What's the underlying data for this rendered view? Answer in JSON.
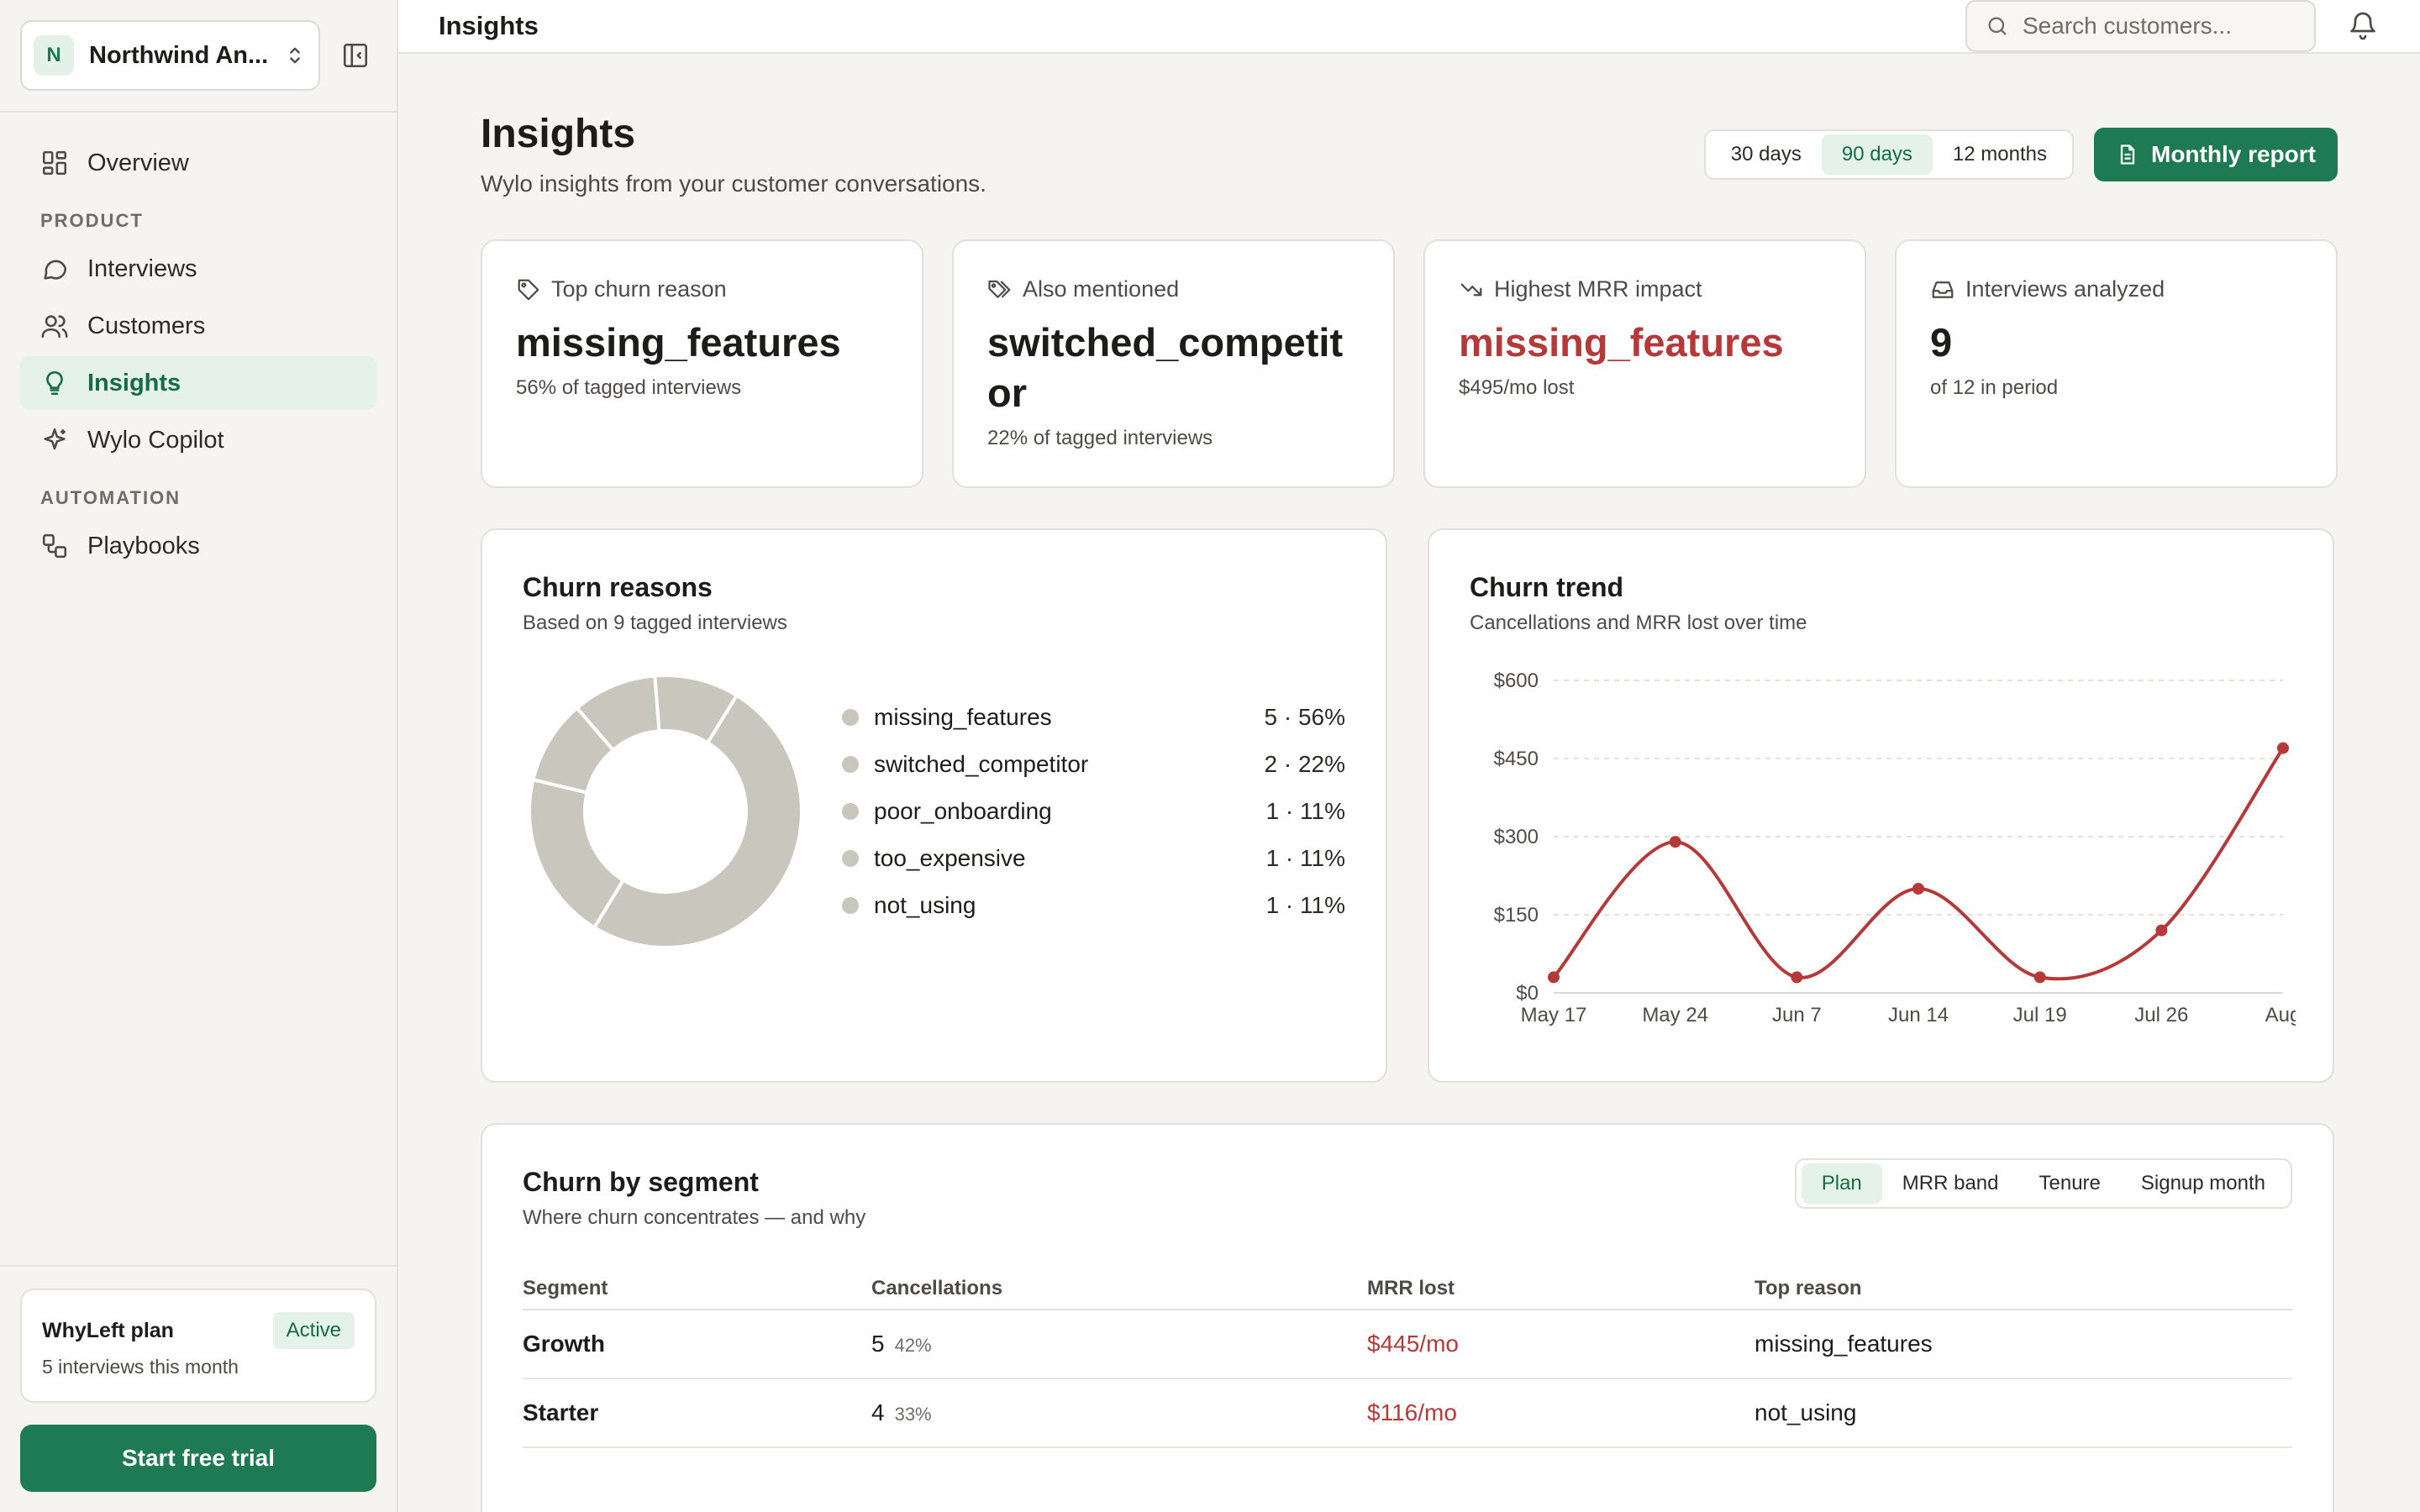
{
  "workspace": {
    "initial": "N",
    "name": "Northwind An..."
  },
  "nav": {
    "overview": "Overview",
    "section_product": "PRODUCT",
    "interviews": "Interviews",
    "customers": "Customers",
    "insights": "Insights",
    "copilot": "Wylo Copilot",
    "section_automation": "AUTOMATION",
    "playbooks": "Playbooks"
  },
  "plan": {
    "name": "WhyLeft plan",
    "badge": "Active",
    "sub": "5 interviews this month",
    "cta": "Start free trial"
  },
  "topbar": {
    "title": "Insights",
    "search_placeholder": "Search customers..."
  },
  "page": {
    "title": "Insights",
    "subtitle": "Wylo insights from your customer conversations."
  },
  "ranges": [
    "30 days",
    "90 days",
    "12 months"
  ],
  "report_button": "Monthly report",
  "kpis": [
    {
      "label": "Top churn reason",
      "value": "missing_features",
      "sub": "56% of tagged interviews"
    },
    {
      "label": "Also mentioned",
      "value": "switched_competitor",
      "sub": "22% of tagged interviews"
    },
    {
      "label": "Highest MRR impact",
      "value": "missing_features",
      "sub": "$495/mo lost"
    },
    {
      "label": "Interviews analyzed",
      "value": "9",
      "sub": "of 12 in period"
    }
  ],
  "churn_reasons": {
    "title": "Churn reasons",
    "subtitle": "Based on 9 tagged interviews"
  },
  "churn_trend": {
    "title": "Churn trend",
    "subtitle": "Cancellations and MRR lost over time"
  },
  "chart_data": [
    {
      "type": "pie",
      "title": "Churn reasons",
      "categories": [
        "missing_features",
        "switched_competitor",
        "poor_onboarding",
        "too_expensive",
        "not_using"
      ],
      "values": [
        5,
        2,
        1,
        1,
        1
      ],
      "labels": [
        "5 · 56%",
        "2 · 22%",
        "1 · 11%",
        "1 · 11%",
        "1 · 11%"
      ],
      "colors": [
        "#c8c6bd"
      ],
      "legend": "right"
    },
    {
      "type": "line",
      "title": "Churn trend",
      "x": [
        "May 17",
        "May 24",
        "Jun 7",
        "Jun 14",
        "Jul 19",
        "Jul 26",
        "Aug"
      ],
      "y_ticks": [
        "$0",
        "$150",
        "$300",
        "$450",
        "$600"
      ],
      "ylim": [
        0,
        600
      ],
      "series": [
        {
          "values": [
            30,
            290,
            30,
            200,
            30,
            120,
            470
          ],
          "color": "#b6393a"
        }
      ],
      "grid": true
    }
  ],
  "segment": {
    "title": "Churn by segment",
    "subtitle": "Where churn concentrates — and why",
    "tabs": [
      "Plan",
      "MRR band",
      "Tenure",
      "Signup month"
    ],
    "columns": [
      "Segment",
      "Cancellations",
      "MRR lost",
      "Top reason"
    ],
    "rows": [
      {
        "segment": "Growth",
        "count": "5",
        "pct": "42%",
        "mrr": "$445/mo",
        "reason": "missing_features"
      },
      {
        "segment": "Starter",
        "count": "4",
        "pct": "33%",
        "mrr": "$116/mo",
        "reason": "not_using"
      }
    ]
  }
}
